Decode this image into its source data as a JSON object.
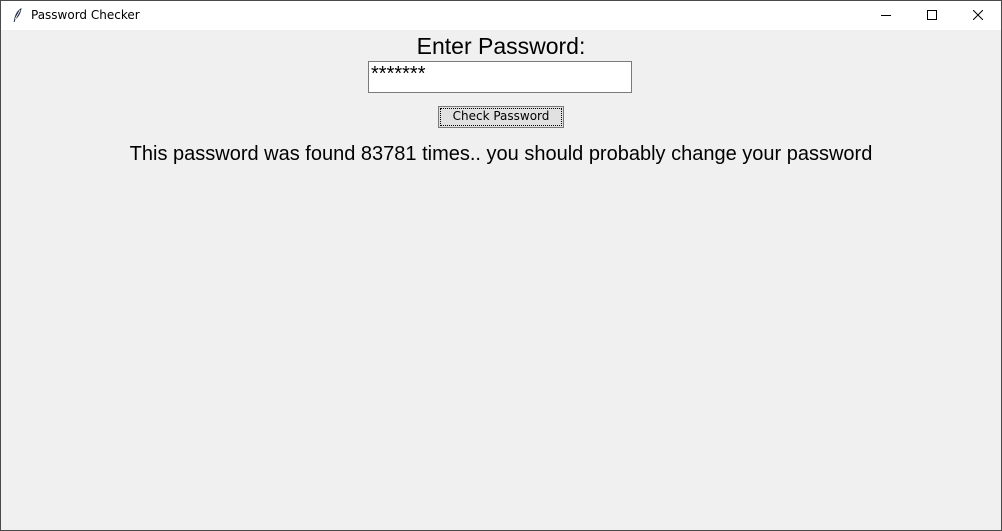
{
  "window": {
    "title": "Password Checker",
    "app_icon": "feather-icon",
    "controls": {
      "minimize_icon": "minimize-icon",
      "maximize_icon": "maximize-icon",
      "close_icon": "close-icon"
    }
  },
  "form": {
    "prompt_label": "Enter Password:",
    "password_value": "*******",
    "check_button_label": "Check Password"
  },
  "result": {
    "message": "This password was found 83781 times.. you should probably change your password"
  }
}
